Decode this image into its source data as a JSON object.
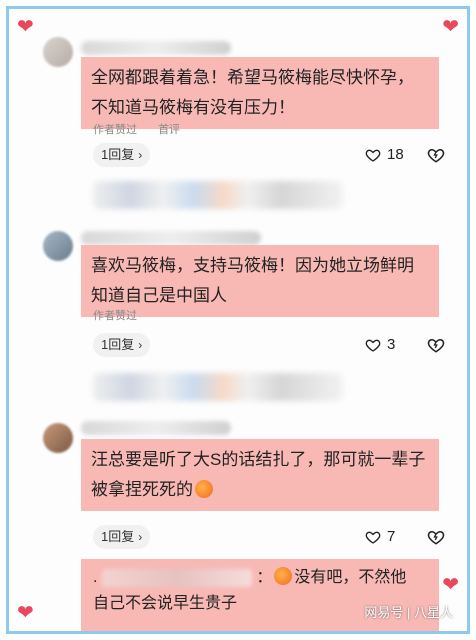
{
  "comments": [
    {
      "text": "全网都跟着着急！希望马筱梅能尽快怀孕，不知道马筱梅有没有压力！",
      "tags": [
        "作者赞过",
        "首评"
      ],
      "reply_label": "1回复",
      "likes": "18"
    },
    {
      "text": "喜欢马筱梅，支持马筱梅！因为她立场鲜明知道自己是中国人",
      "tags": [
        "作者赞过"
      ],
      "reply_label": "1回复",
      "likes": "3"
    },
    {
      "text": "汪总要是听了大S的话结扎了，那可就一辈子被拿捏死死的",
      "tags": [],
      "reply_label": "1回复",
      "likes": "7"
    }
  ],
  "reply_preview": {
    "prefix": ".",
    "separator": "：",
    "text_line1": "没有吧，不然他",
    "text_line2": "自己不会说早生贵子"
  },
  "watermark": "网易号 | 八星人",
  "colors": {
    "highlight": "#f8b9b5",
    "frame_border": "#8ec9f0",
    "heart_decoration": "#e8475c"
  }
}
